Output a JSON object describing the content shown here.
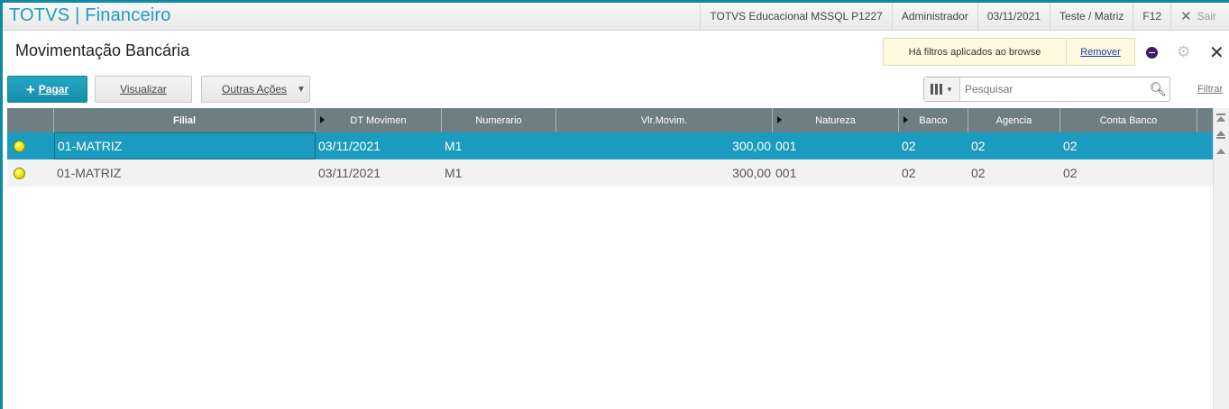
{
  "app": {
    "title": "TOTVS | Financeiro"
  },
  "topbar": {
    "environment": "TOTVS Educacional MSSQL P1227",
    "user": "Administrador",
    "date": "03/11/2021",
    "company": "Teste / Matriz",
    "shortcut": "F12",
    "exit_label": "Sair"
  },
  "page": {
    "title": "Movimentação Bancária"
  },
  "filter_notice": {
    "message": "Há filtros aplicados ao browse",
    "remove_label": "Remover"
  },
  "toolbar": {
    "pay_label": "Pagar",
    "view_label": "Visualizar",
    "more_label": "Outras Ações"
  },
  "search": {
    "placeholder": "Pesquisar",
    "filter_label": "Filtrar"
  },
  "grid": {
    "columns": [
      "",
      "Filial",
      "DT Movimen",
      "Numerario",
      "Vlr.Movim.",
      "Natureza",
      "Banco",
      "Agencia",
      "Conta Banco"
    ],
    "rows": [
      {
        "status": "yellow",
        "filial": "01-MATRIZ",
        "dt": "03/11/2021",
        "numerario": "M1",
        "valor": "300,00",
        "natureza": "001",
        "banco": "02",
        "agencia": "02",
        "conta": "02",
        "selected": true
      },
      {
        "status": "yellow",
        "filial": "01-MATRIZ",
        "dt": "03/11/2021",
        "numerario": "M1",
        "valor": "300,00",
        "natureza": "001",
        "banco": "02",
        "agencia": "02",
        "conta": "02",
        "selected": false
      }
    ]
  },
  "colors": {
    "accent": "#1a9bbf",
    "header_bg": "#6e7f83",
    "brand": "#1e9cc0",
    "status_yellow": "#e6e000"
  },
  "icons": [
    "close-icon",
    "gear-icon",
    "search-icon",
    "columns-icon",
    "plus-icon",
    "status-dot-icon"
  ]
}
